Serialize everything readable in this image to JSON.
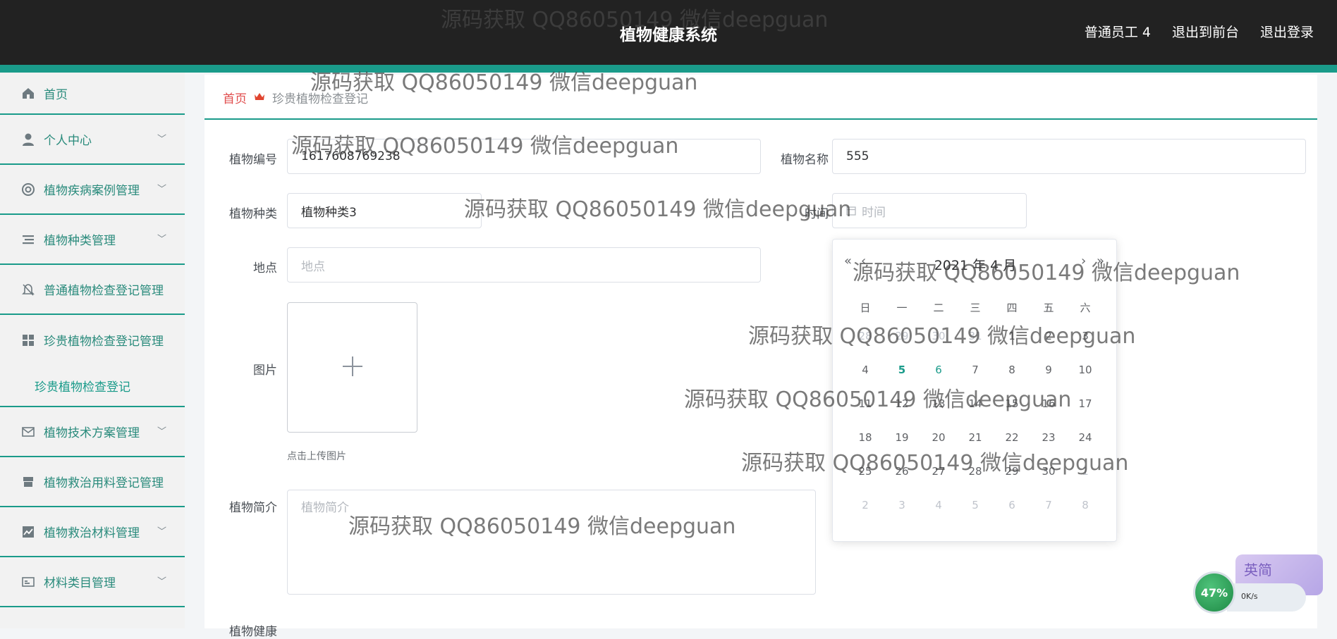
{
  "header": {
    "title": "植物健康系统",
    "links": [
      "普通员工 4",
      "退出到前台",
      "退出登录"
    ]
  },
  "sidebar": {
    "items": [
      {
        "label": "首页",
        "icon": "home-icon"
      },
      {
        "label": "个人中心",
        "icon": "user-icon"
      },
      {
        "label": "植物疾病案例管理",
        "icon": "lifebuoy-icon"
      },
      {
        "label": "植物种类管理",
        "icon": "list-icon"
      },
      {
        "label": "普通植物检查登记管理",
        "icon": "bell-off-icon"
      },
      {
        "label": "珍贵植物检查登记管理",
        "icon": "grid-icon"
      },
      {
        "label": "珍贵植物检查登记",
        "icon": ""
      },
      {
        "label": "植物技术方案管理",
        "icon": "mail-icon"
      },
      {
        "label": "植物救治用料登记管理",
        "icon": "shop-icon"
      },
      {
        "label": "植物救治材料管理",
        "icon": "chart-icon"
      },
      {
        "label": "材料类目管理",
        "icon": "card-icon"
      }
    ]
  },
  "breadcrumb": {
    "home": "首页",
    "current": "珍贵植物检查登记"
  },
  "form": {
    "plant_no_label": "植物编号",
    "plant_no_value": "1617608769238",
    "plant_name_label": "植物名称",
    "plant_name_value": "555",
    "plant_type_label": "植物种类",
    "plant_type_value": "植物种类3",
    "time_label": "时间",
    "time_placeholder": "时间",
    "location_label": "地点",
    "location_placeholder": "地点",
    "image_label": "图片",
    "upload_tip": "点击上传图片",
    "intro_label": "植物简介",
    "intro_placeholder": "植物简介",
    "health_label": "植物健康"
  },
  "datepicker": {
    "header": "2021 年 4 月",
    "weekdays": [
      "日",
      "一",
      "二",
      "三",
      "四",
      "五",
      "六"
    ],
    "days": [
      {
        "d": "28",
        "s": "muted"
      },
      {
        "d": "29",
        "s": "muted"
      },
      {
        "d": "30",
        "s": "muted"
      },
      {
        "d": "31",
        "s": "muted"
      },
      {
        "d": "1",
        "s": ""
      },
      {
        "d": "2",
        "s": ""
      },
      {
        "d": "3",
        "s": ""
      },
      {
        "d": "4",
        "s": ""
      },
      {
        "d": "5",
        "s": "today"
      },
      {
        "d": "6",
        "s": "hover"
      },
      {
        "d": "7",
        "s": ""
      },
      {
        "d": "8",
        "s": ""
      },
      {
        "d": "9",
        "s": ""
      },
      {
        "d": "10",
        "s": ""
      },
      {
        "d": "11",
        "s": ""
      },
      {
        "d": "12",
        "s": ""
      },
      {
        "d": "13",
        "s": ""
      },
      {
        "d": "14",
        "s": ""
      },
      {
        "d": "15",
        "s": ""
      },
      {
        "d": "16",
        "s": ""
      },
      {
        "d": "17",
        "s": ""
      },
      {
        "d": "18",
        "s": ""
      },
      {
        "d": "19",
        "s": ""
      },
      {
        "d": "20",
        "s": ""
      },
      {
        "d": "21",
        "s": ""
      },
      {
        "d": "22",
        "s": ""
      },
      {
        "d": "23",
        "s": ""
      },
      {
        "d": "24",
        "s": ""
      },
      {
        "d": "25",
        "s": ""
      },
      {
        "d": "26",
        "s": ""
      },
      {
        "d": "27",
        "s": ""
      },
      {
        "d": "28",
        "s": ""
      },
      {
        "d": "29",
        "s": ""
      },
      {
        "d": "30",
        "s": ""
      },
      {
        "d": "1",
        "s": "muted"
      },
      {
        "d": "2",
        "s": "muted"
      },
      {
        "d": "3",
        "s": "muted"
      },
      {
        "d": "4",
        "s": "muted"
      },
      {
        "d": "5",
        "s": "muted"
      },
      {
        "d": "6",
        "s": "muted"
      },
      {
        "d": "7",
        "s": "muted"
      },
      {
        "d": "8",
        "s": "muted"
      }
    ]
  },
  "watermark": "源码获取 QQ86050149 微信deepguan",
  "system_monitor": {
    "percent": "47%",
    "speed": "0K/s"
  },
  "ime": {
    "label": "英简"
  }
}
